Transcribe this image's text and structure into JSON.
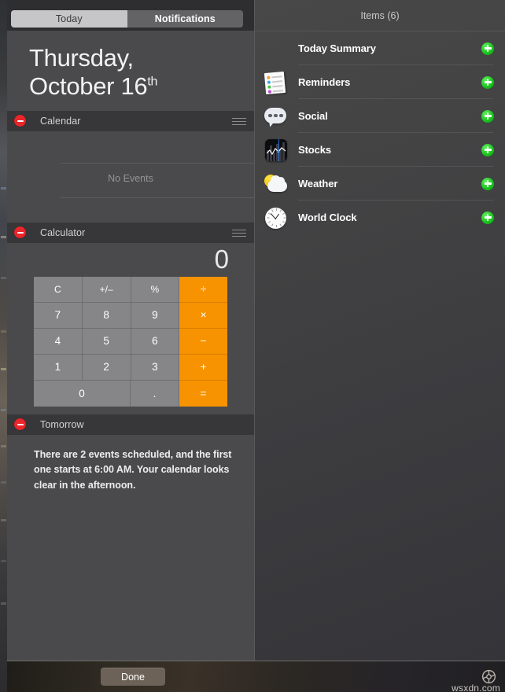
{
  "tabs": {
    "today_label": "Today",
    "notifications_label": "Notifications",
    "selected": "Today"
  },
  "today": {
    "date_weekday": "Thursday,",
    "date_month_day": "October 16",
    "date_ordinal": "th",
    "widgets": [
      {
        "name": "Calendar",
        "remove_label": "remove",
        "drag_label": "reorder",
        "empty_text": "No Events"
      },
      {
        "name": "Calculator",
        "remove_label": "remove",
        "drag_label": "reorder",
        "display_value": "0",
        "keys": [
          [
            {
              "label": "C",
              "type": "fn"
            },
            {
              "label": "+/–",
              "type": "fn"
            },
            {
              "label": "%",
              "type": "fn"
            },
            {
              "label": "÷",
              "type": "op"
            }
          ],
          [
            {
              "label": "7",
              "type": "num"
            },
            {
              "label": "8",
              "type": "num"
            },
            {
              "label": "9",
              "type": "num"
            },
            {
              "label": "×",
              "type": "op"
            }
          ],
          [
            {
              "label": "4",
              "type": "num"
            },
            {
              "label": "5",
              "type": "num"
            },
            {
              "label": "6",
              "type": "num"
            },
            {
              "label": "−",
              "type": "op"
            }
          ],
          [
            {
              "label": "1",
              "type": "num"
            },
            {
              "label": "2",
              "type": "num"
            },
            {
              "label": "3",
              "type": "num"
            },
            {
              "label": "+",
              "type": "op"
            }
          ],
          [
            {
              "label": "0",
              "type": "num-wide"
            },
            {
              "label": ".",
              "type": "num"
            },
            {
              "label": "=",
              "type": "op"
            }
          ]
        ]
      },
      {
        "name": "Tomorrow",
        "remove_label": "remove",
        "body_text": "There are 2 events scheduled, and the first one starts at 6:00 AM. Your calendar looks clear in the afternoon."
      }
    ]
  },
  "items_panel": {
    "header": "Items (6)",
    "items": [
      {
        "label": "Today Summary",
        "icon": "none",
        "add_label": "add"
      },
      {
        "label": "Reminders",
        "icon": "reminders-icon",
        "add_label": "add"
      },
      {
        "label": "Social",
        "icon": "social-icon",
        "add_label": "add"
      },
      {
        "label": "Stocks",
        "icon": "stocks-icon",
        "add_label": "add"
      },
      {
        "label": "Weather",
        "icon": "weather-icon",
        "add_label": "add"
      },
      {
        "label": "World Clock",
        "icon": "world-clock-icon",
        "add_label": "add"
      }
    ]
  },
  "bottom_bar": {
    "done_label": "Done",
    "settings_icon": "gear-icon",
    "watermark": "wsxdn.com"
  },
  "colors": {
    "accent_orange": "#f79200",
    "remove_red": "#e8262b",
    "add_green": "#18c21c",
    "panel_bg": "#4a4a4c",
    "widget_title_bg": "#37373a"
  }
}
